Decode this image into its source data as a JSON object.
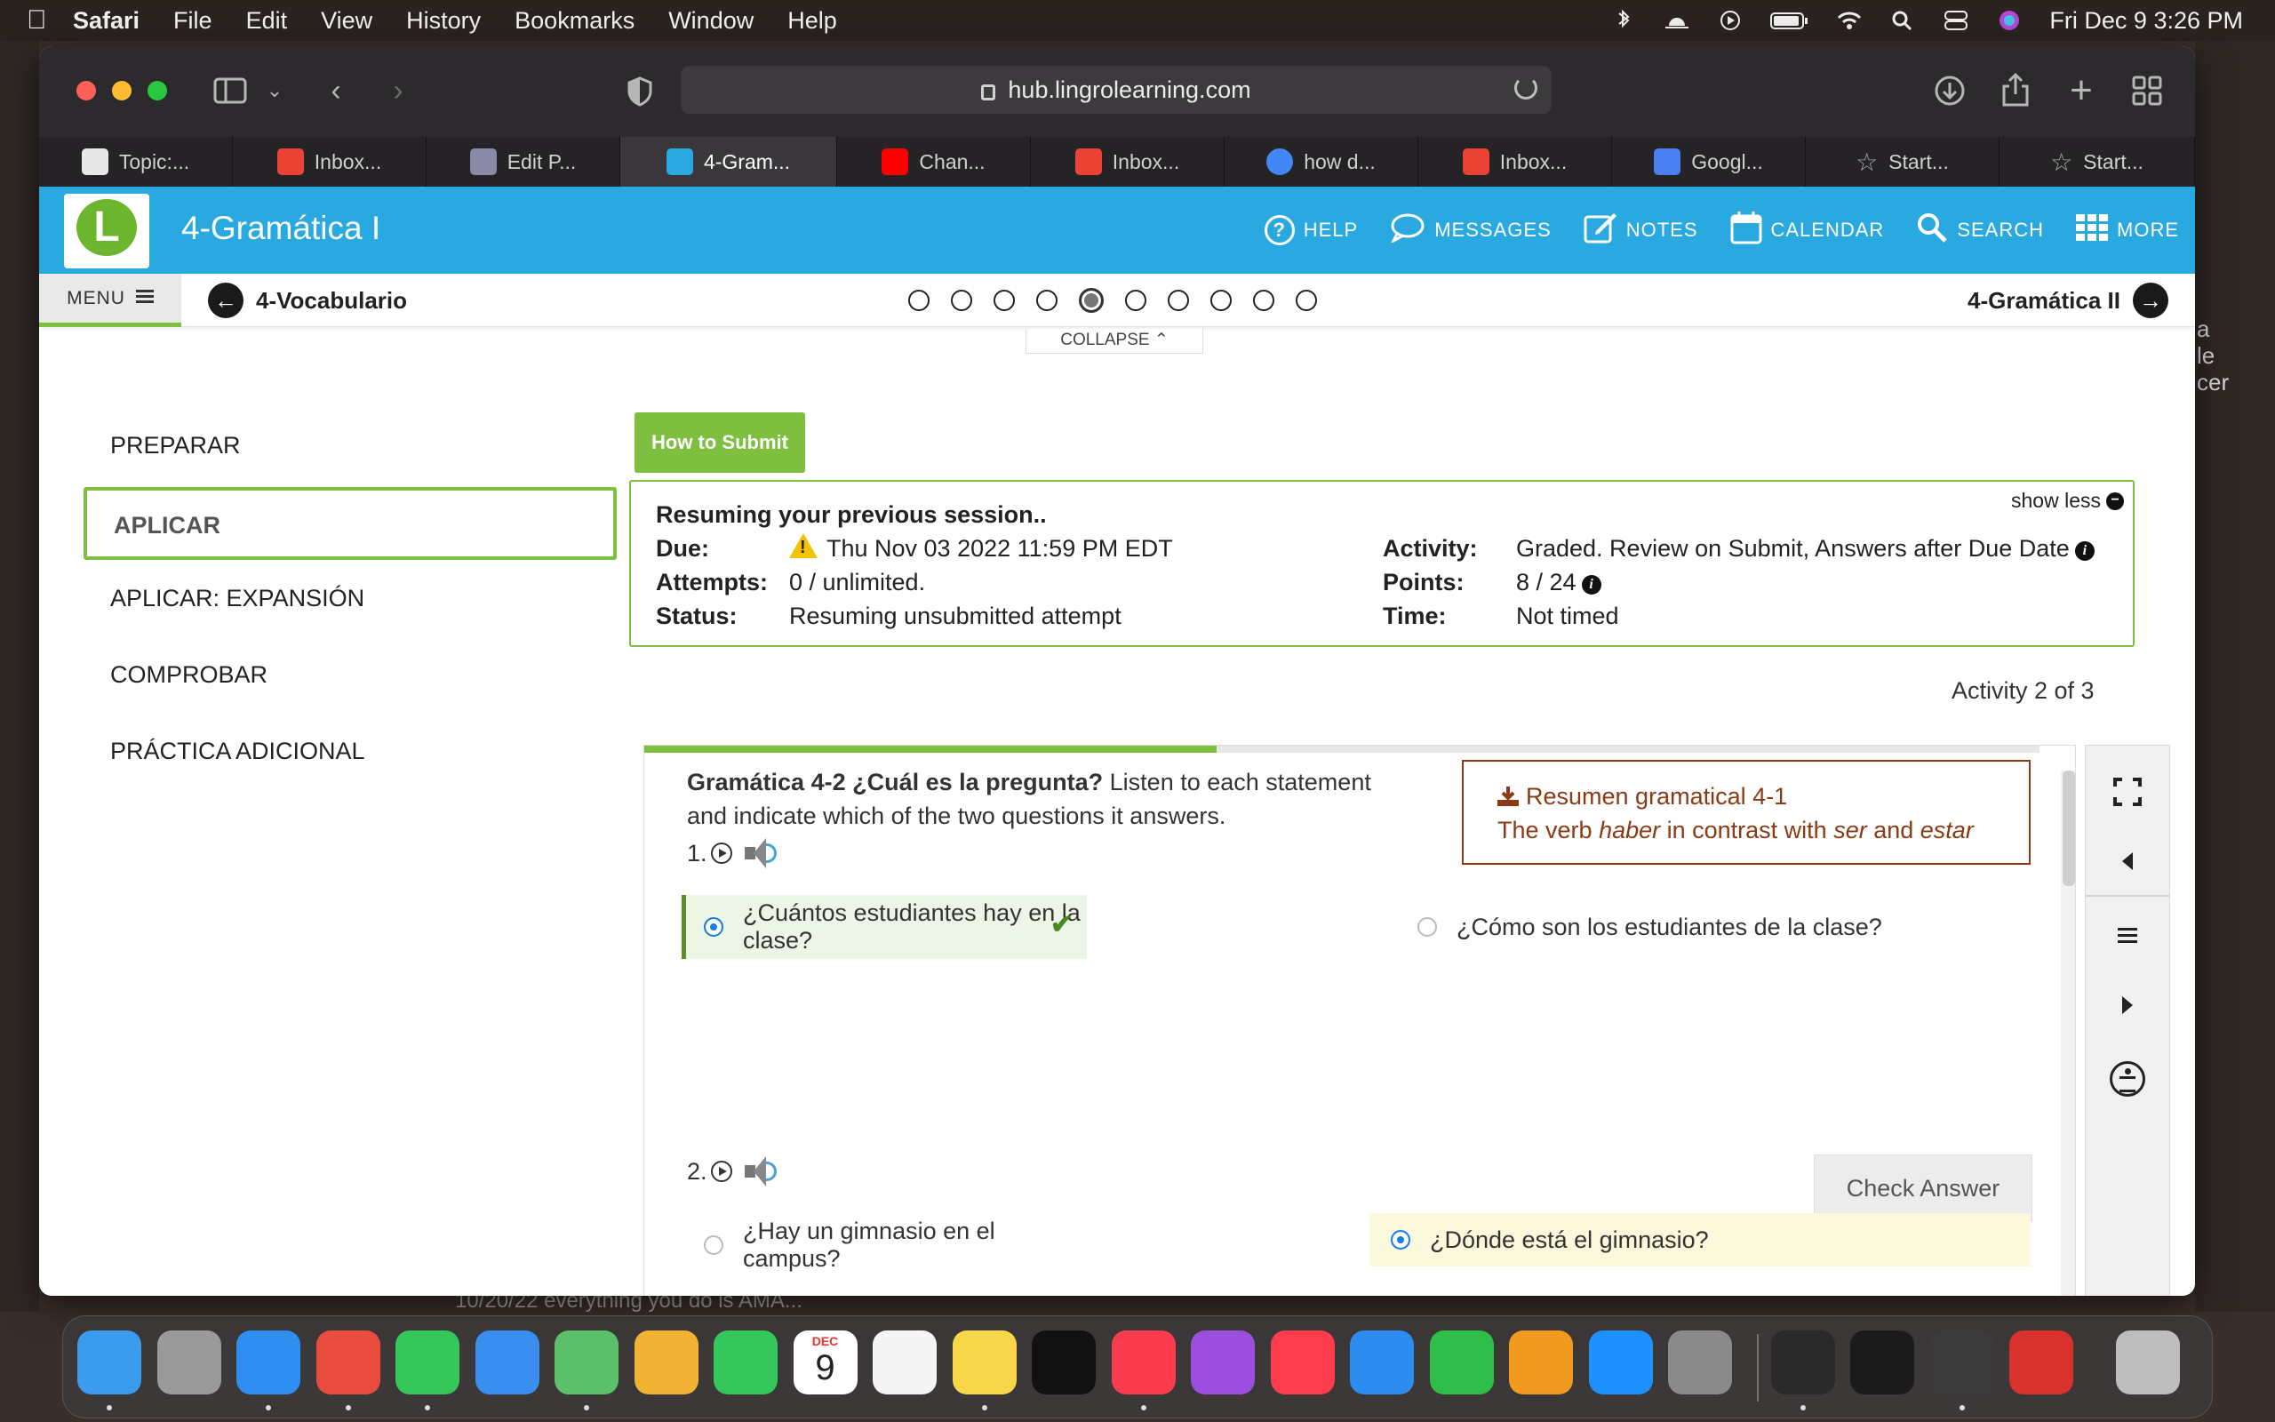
{
  "menubar": {
    "app": "Safari",
    "items": [
      "File",
      "Edit",
      "View",
      "History",
      "Bookmarks",
      "Window",
      "Help"
    ],
    "datetime": "Fri Dec 9  3:26 PM"
  },
  "browser": {
    "url": "hub.lingrolearning.com",
    "tabs": [
      {
        "label": "Topic:...",
        "favicon_color": "#e8e8e8"
      },
      {
        "label": "Inbox...",
        "favicon_color": "#ea4335"
      },
      {
        "label": "Edit P...",
        "favicon_color": "#8a8aa8"
      },
      {
        "label": "4-Gram...",
        "favicon_color": "#29a9e0",
        "active": true
      },
      {
        "label": "Chan...",
        "favicon_color": "#ff0000"
      },
      {
        "label": "Inbox...",
        "favicon_color": "#ea4335"
      },
      {
        "label": "how d...",
        "favicon_color": "#4285f4"
      },
      {
        "label": "Inbox...",
        "favicon_color": "#ea4335"
      },
      {
        "label": "Googl...",
        "favicon_color": "#4a7ff0"
      },
      {
        "label": "Start...",
        "favicon_color": "#888888"
      },
      {
        "label": "Start...",
        "favicon_color": "#888888"
      }
    ]
  },
  "header": {
    "course_title": "4-Gramática I",
    "logo_letter": "L",
    "nav": [
      {
        "label": "HELP",
        "icon": "help-icon"
      },
      {
        "label": "MESSAGES",
        "icon": "messages-icon"
      },
      {
        "label": "NOTES",
        "icon": "notes-icon"
      },
      {
        "label": "CALENDAR",
        "icon": "calendar-icon"
      },
      {
        "label": "SEARCH",
        "icon": "search-icon"
      },
      {
        "label": "MORE",
        "icon": "grid-icon"
      }
    ]
  },
  "subbar": {
    "menu_label": "MENU",
    "prev_label": "4-Vocabulario",
    "next_label": "4-Gramática II",
    "dots_total": 10,
    "dots_current": 5,
    "collapse_label": "COLLAPSE"
  },
  "sidebar": {
    "items": [
      "PREPARAR",
      "APLICAR",
      "APLICAR: EXPANSIÓN",
      "COMPROBAR",
      "PRÁCTICA ADICIONAL"
    ],
    "active_index": 1
  },
  "main": {
    "how_to_submit": "How to Submit",
    "info": {
      "show_less": "show less",
      "resuming": "Resuming your previous session..",
      "due_label": "Due:",
      "due_value": "Thu Nov 03 2022 11:59 PM EDT",
      "attempts_label": "Attempts:",
      "attempts_value": "0 / unlimited.",
      "status_label": "Status:",
      "status_value": "Resuming unsubmitted attempt",
      "activity_label": "Activity:",
      "activity_value": "Graded. Review on Submit, Answers after Due Date",
      "points_label": "Points:",
      "points_value": "8 / 24",
      "time_label": "Time:",
      "time_value": "Not timed"
    },
    "activity_count": "Activity 2 of 3",
    "progress_fraction": 0.41,
    "exercise": {
      "title_bold": "Gramática 4-2 ¿Cuál es la pregunta?",
      "title_rest": " Listen to each statement and indicate which of the two questions it answers.",
      "resumen_line1": "Resumen gramatical 4-1",
      "resumen_line2_a": "The verb ",
      "resumen_line2_b": "haber",
      "resumen_line2_c": " in contrast with ",
      "resumen_line2_d": "ser",
      "resumen_line2_e": " and ",
      "resumen_line2_f": "estar",
      "q1_number": "1.",
      "q1_option_a": "¿Cuántos estudiantes hay en la clase?",
      "q1_option_b": "¿Cómo son los estudiantes de la clase?",
      "check_answer": "Check Answer",
      "q2_number": "2.",
      "q2_option_a": "¿Hay un gimnasio en el campus?",
      "q2_option_b": "¿Dónde está el gimnasio?"
    }
  },
  "desktop": {
    "right_text": [
      "a",
      "le",
      "cer"
    ],
    "bottom_text": "10/20/22   everything you do is AMA..."
  },
  "dock": {
    "calendar_month": "DEC",
    "calendar_day": "9",
    "apps": [
      {
        "name": "finder-icon",
        "color": "#3a9bef"
      },
      {
        "name": "launchpad-icon",
        "color": "#9a9a9a"
      },
      {
        "name": "safari-icon",
        "color": "#2e8ff0"
      },
      {
        "name": "chrome-icon",
        "color": "#e74c3c"
      },
      {
        "name": "messages-app-icon",
        "color": "#35c759"
      },
      {
        "name": "mail-icon",
        "color": "#3a8ef0"
      },
      {
        "name": "maps-icon",
        "color": "#5cbf6a"
      },
      {
        "name": "photos-icon",
        "color": "#f2b233"
      },
      {
        "name": "facetime-icon",
        "color": "#35c759"
      },
      {
        "name": "calendar-app-icon",
        "color": "#ffffff"
      },
      {
        "name": "reminders-icon",
        "color": "#f5f5f5"
      },
      {
        "name": "notes-app-icon",
        "color": "#f7d64a"
      },
      {
        "name": "tv-icon",
        "color": "#111111"
      },
      {
        "name": "music-icon",
        "color": "#fb3c4e"
      },
      {
        "name": "podcasts-icon",
        "color": "#9b4ee0"
      },
      {
        "name": "news-icon",
        "color": "#ff3b4e"
      },
      {
        "name": "keynote-icon",
        "color": "#2d8cf0"
      },
      {
        "name": "numbers-icon",
        "color": "#2fbe4a"
      },
      {
        "name": "pages-icon",
        "color": "#f29a1f"
      },
      {
        "name": "app-store-icon",
        "color": "#1e90ff"
      },
      {
        "name": "system-preferences-icon",
        "color": "#8a8a8a"
      },
      {
        "name": "quicktime-icon",
        "color": "#2a2a2a"
      },
      {
        "name": "activity-monitor-icon",
        "color": "#1b1b1b"
      },
      {
        "name": "calculator-icon",
        "color": "#3a3a3a"
      },
      {
        "name": "photo-booth-icon",
        "color": "#d9312b"
      },
      {
        "name": "trash-icon",
        "color": "#bdbdbd"
      }
    ]
  }
}
